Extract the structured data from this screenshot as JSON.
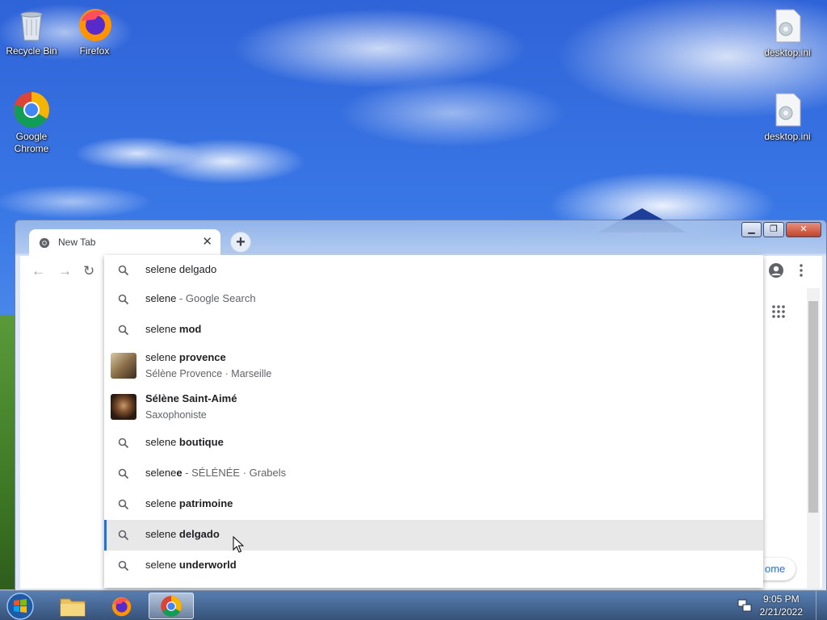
{
  "desktop": {
    "icons": [
      {
        "label": "Recycle Bin"
      },
      {
        "label": "Firefox"
      },
      {
        "label": "Google Chrome"
      },
      {
        "label": "desktop.ini"
      },
      {
        "label": "desktop.ini"
      }
    ]
  },
  "browser": {
    "tab_title": "New Tab",
    "omnibox_value": "selene delgado",
    "partial_button": "ome"
  },
  "suggestions": [
    {
      "icon": "search-icon",
      "plain": "selene",
      "bold": "",
      "suffix": " - Google Search"
    },
    {
      "icon": "search-icon",
      "plain": "selene ",
      "bold": "mod",
      "suffix": ""
    },
    {
      "icon": "thumbnail",
      "line1_plain": "selene ",
      "line1_bold": "provence",
      "line2": "Sélène Provence · Marseille"
    },
    {
      "icon": "thumbnail",
      "line1_plain": "",
      "line1_bold": "Sélène Saint-Aimé",
      "line2": "Saxophoniste"
    },
    {
      "icon": "search-icon",
      "plain": "selene ",
      "bold": "boutique",
      "suffix": ""
    },
    {
      "icon": "search-icon",
      "plain": "selene",
      "bold": "e",
      "suffix": " - SÉLÉNÉE · Grabels"
    },
    {
      "icon": "search-icon",
      "plain": "selene ",
      "bold": "patrimoine",
      "suffix": ""
    },
    {
      "icon": "search-icon",
      "plain": "selene ",
      "bold": "delgado",
      "suffix": "",
      "selected": true
    },
    {
      "icon": "search-icon",
      "plain": "selene ",
      "bold": "underworld",
      "suffix": ""
    }
  ],
  "taskbar": {
    "time": "9:05 PM",
    "date": "2/21/2022"
  }
}
